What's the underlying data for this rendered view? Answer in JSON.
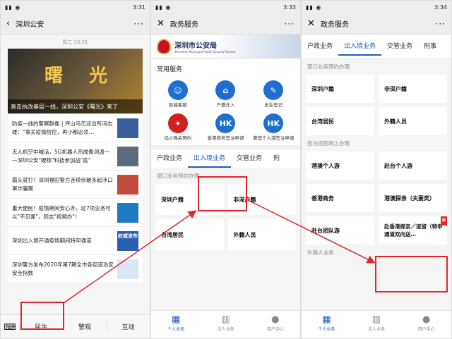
{
  "panel1": {
    "status_time": "3:31",
    "nav_title": "深圳公安",
    "timestamp": "周二 10:51",
    "hero": {
      "headline": "曙 光",
      "caption": "直击执改基层一线，深圳公安《曙光》来了"
    },
    "news": [
      {
        "text": "防疫一线的警察群像 | 坪山马峦派出所冯志雄：\"事关疫情防控，再小都必须…"
      },
      {
        "text": "无人机空中喊话，5G机器人热成像测温一—深圳公安\"硬核\"科技参加战\"疫\""
      },
      {
        "text": "霸头就打！深圳福田警方连续侦破多起涉口罩诈骗案"
      },
      {
        "text": "重大便民！疫情期间安心办，这7项业务可以\"不见面\"，同志\"视频办\"！"
      },
      {
        "text": "深圳出入境开通疫情期间特申通道",
        "thumb": "权威发布"
      },
      {
        "text": "深圳警方发布2020年第7期全市各街道治安安全指数"
      }
    ],
    "menu": [
      "民生",
      "警观",
      "互动"
    ]
  },
  "panel2": {
    "status_time": "3:33",
    "nav_title": "政务服务",
    "banner_title": "深圳市公安局",
    "banner_sub": "Shenzhen Municipal Public Security Bureau",
    "section_title": "常用服务",
    "services": [
      {
        "label": "智能客服",
        "color": "#1f6fd1",
        "glyph": "☺"
      },
      {
        "label": "户籍迁入",
        "color": "#1f6fd1",
        "glyph": "⌂"
      },
      {
        "label": "出生登记",
        "color": "#1f6fd1",
        "glyph": "✎"
      },
      {
        "label": "焰火晚会预约",
        "color": "#d02020",
        "glyph": "✦"
      },
      {
        "label": "香港商务签注申请",
        "color": "#1f6fd1",
        "glyph": "HK"
      },
      {
        "label": "港澳个人游签注申请",
        "color": "#1f6fd1",
        "glyph": "HK"
      }
    ],
    "tabs": [
      "户政业务",
      "出入境业务",
      "交管业务",
      "刑"
    ],
    "sub_title": "窗口业务预约办理",
    "buttons": [
      "深圳户籍",
      "非深户籍",
      "台湾居民",
      "外籍人员"
    ],
    "bottom": [
      "个人业务",
      "法人业务",
      "用户中心"
    ]
  },
  "panel3": {
    "status_time": "3:34",
    "nav_title": "政务服务",
    "tabs": [
      "户政业务",
      "出入境业务",
      "交管业务",
      "刑事"
    ],
    "sub_title1": "窗口业务预约办理",
    "buttons1": [
      "深圳户籍",
      "非深户籍",
      "台湾居民",
      "外籍人员"
    ],
    "sub_title2": "签注续签网上办理",
    "buttons2": [
      "港澳个人游",
      "赴台个人游",
      "香港商务",
      "港澳探亲（夫妻类）",
      "赴台团队游",
      "赴香港探亲／逗留（特申通道双向送…"
    ],
    "new_badge": "新",
    "sub_title3": "外国人业务",
    "bottom": [
      "个人业务",
      "法人业务",
      "用户中心"
    ]
  },
  "colors": {
    "accent": "#1a5cc8",
    "highlight": "#e0262c"
  }
}
